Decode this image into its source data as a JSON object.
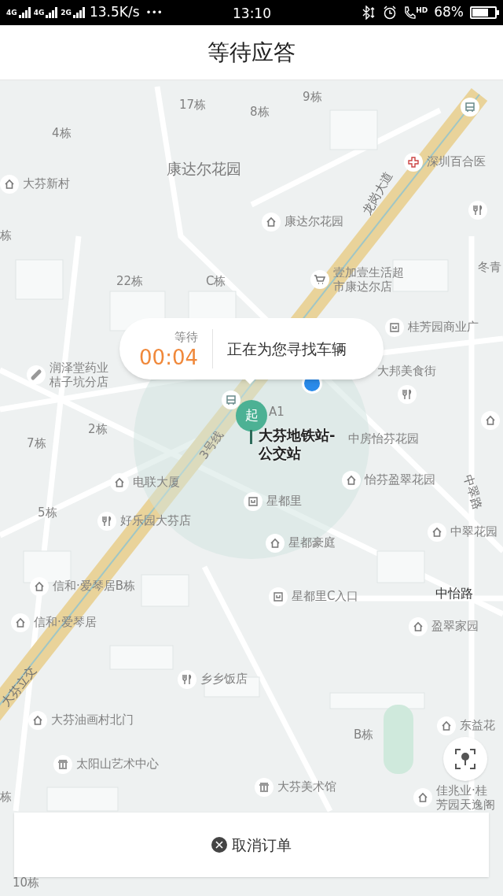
{
  "status_bar": {
    "signal_labels": [
      "4G",
      "4G",
      "2G"
    ],
    "speed": "13.5K/s",
    "more": "•••",
    "time": "13:10",
    "hd": "HD",
    "battery": "68%"
  },
  "title": "等待应答",
  "map": {
    "labels": [
      {
        "kind": "plain",
        "text": "17栋"
      },
      {
        "kind": "plain",
        "text": "8栋"
      },
      {
        "kind": "plain",
        "text": "9栋"
      },
      {
        "kind": "plain",
        "text": "4栋"
      },
      {
        "kind": "area",
        "text": "康达尔花园"
      },
      {
        "kind": "hospital",
        "text": "深圳百合医"
      },
      {
        "kind": "home",
        "text": "大芬新村"
      },
      {
        "kind": "home",
        "text": "康达尔花园"
      },
      {
        "kind": "plain",
        "text": "栋"
      },
      {
        "kind": "road",
        "text": "龙岗大道"
      },
      {
        "kind": "plain",
        "text": "22栋"
      },
      {
        "kind": "plain",
        "text": "C栋"
      },
      {
        "kind": "shop",
        "text": "壹加壹生活超市康达尔店"
      },
      {
        "kind": "plain",
        "text": "冬青"
      },
      {
        "kind": "mall",
        "text": "桂芳园商业广"
      },
      {
        "kind": "pill",
        "text": "润泽堂药业桔子坑分店"
      },
      {
        "kind": "plain",
        "text": "大邦美食街"
      },
      {
        "kind": "plain",
        "text": "2栋"
      },
      {
        "kind": "plain",
        "text": "7栋"
      },
      {
        "kind": "plain",
        "text": "中房怡芬花园"
      },
      {
        "kind": "home",
        "text": "怡芬盈翠花园"
      },
      {
        "kind": "road",
        "text": "中翠路"
      },
      {
        "kind": "home",
        "text": "电联大厦"
      },
      {
        "kind": "mall",
        "text": "星都里"
      },
      {
        "kind": "plain",
        "text": "5栋"
      },
      {
        "kind": "food",
        "text": "好乐园大芬店"
      },
      {
        "kind": "home",
        "text": "中翠花园"
      },
      {
        "kind": "home",
        "text": "星都豪庭"
      },
      {
        "kind": "home",
        "text": "信和·爱琴居B栋"
      },
      {
        "kind": "mall",
        "text": "星都里C入口"
      },
      {
        "kind": "street",
        "text": "中怡路"
      },
      {
        "kind": "home",
        "text": "信和·爱琴居"
      },
      {
        "kind": "home",
        "text": "盈翠家园"
      },
      {
        "kind": "road",
        "text": "大芬立交"
      },
      {
        "kind": "food",
        "text": "乡乡饭店"
      },
      {
        "kind": "home",
        "text": "大芬油画村北门"
      },
      {
        "kind": "plain",
        "text": "B栋"
      },
      {
        "kind": "home",
        "text": "东益花"
      },
      {
        "kind": "museum",
        "text": "太阳山艺术中心"
      },
      {
        "kind": "museum",
        "text": "大芬美术馆"
      },
      {
        "kind": "plain",
        "text": "栋"
      },
      {
        "kind": "home",
        "text": "佳兆业·桂芳园天逸阁"
      },
      {
        "kind": "plain",
        "text": "10栋"
      },
      {
        "kind": "plain",
        "text": "3号线"
      },
      {
        "kind": "plain",
        "text": "A1"
      }
    ]
  },
  "waiting": {
    "label": "等待",
    "timer": "00:04",
    "message": "正在为您寻找车辆"
  },
  "pickup": {
    "marker": "起",
    "name": "大芬地铁站-公交站"
  },
  "cancel_button": "取消订单"
}
